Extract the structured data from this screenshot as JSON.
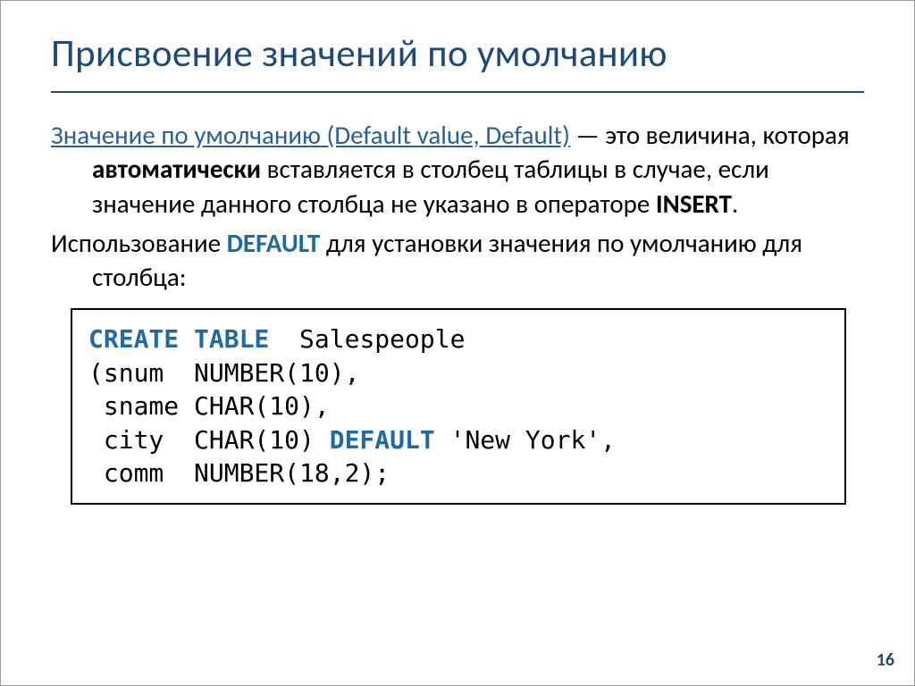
{
  "slide": {
    "title": "Присвоение значений по умолчанию",
    "p1_link": "Значение по умолчанию (Default value, Default)",
    "p1_rest1": " — это величина, которая ",
    "p1_bold1": "автоматически",
    "p1_rest2": " вставляется в столбец таблицы в случае, если значение данного столбца не указано в операторе ",
    "p1_bold2": "INSERT",
    "p1_rest3": ".",
    "p2_a": "Использование ",
    "p2_kw": "DEFAULT",
    "p2_b": " для установки значения по умолчанию для столбца:",
    "code": {
      "kw1": "CREATE TABLE",
      "rest1": "  Salespeople",
      "line2": "(snum  NUMBER(10),",
      "line3": " sname CHAR(10),",
      "line4a": " city  CHAR(10) ",
      "kw2": "DEFAULT",
      "line4b": " 'New York',",
      "line5": " comm  NUMBER(18,2);"
    },
    "page_number": "16"
  }
}
